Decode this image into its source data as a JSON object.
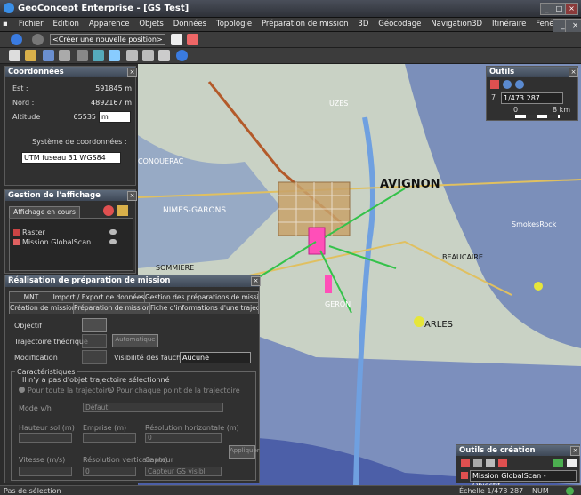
{
  "window": {
    "title": "GeoConcept Enterprise - [GS Test]"
  },
  "menu": [
    "Fichier",
    "Edition",
    "Apparence",
    "Objets",
    "Données",
    "Topologie",
    "Préparation de mission",
    "3D",
    "Géocodage",
    "Navigation3D",
    "Itinéraire",
    "Fenêtres",
    "?"
  ],
  "toolbar": {
    "position_combo": "<Créer une nouvelle position>"
  },
  "coords": {
    "title": "Coordonnées",
    "est_label": "Est :",
    "est_value": "591845 m",
    "nord_label": "Nord :",
    "nord_value": "4892167 m",
    "alt_label": "Altitude",
    "alt_value": "65535",
    "alt_unit": "m",
    "system_label": "Système de coordonnées :",
    "system_value": "UTM fuseau 31 WGS84"
  },
  "display": {
    "title": "Gestion de l'affichage",
    "tab": "Affichage en cours",
    "layers": [
      "Raster",
      "Mission GlobalScan"
    ]
  },
  "mission": {
    "title": "Réalisation de préparation de mission",
    "tabs_row1": [
      "MNT",
      "Import / Export de données",
      "Gestion des préparations de mission"
    ],
    "tabs_row2": [
      "Création de mission",
      "Préparation de mission",
      "Fiche d'informations d'une trajectoire"
    ],
    "objectif": "Objectif",
    "trajectoire": "Trajectoire théorique",
    "modification": "Modification",
    "automatique": "Automatique",
    "visibilite": "Visibilité des fauchées",
    "visibilite_value": "Aucune",
    "caracteristiques": "Caractéristiques",
    "no_object": "Il n'y a pas d'objet trajectoire sélectionné",
    "radio1": "Pour toute la trajectoire",
    "radio2": "Pour chaque point de la trajectoire",
    "mode_label": "Mode v/h",
    "mode_value": "Défaut",
    "hauteur": "Hauteur sol (m)",
    "emprise": "Emprise (m)",
    "res_h": "Résolution horizontale (m)",
    "res_h_value": "0",
    "appliquer": "Appliquer",
    "vitesse": "Vitesse (m/s)",
    "res_v": "Résolution verticale (m)",
    "res_v_value": "0",
    "capteur": "Capteur",
    "capteur_value": "Capteur GS visibl"
  },
  "outils": {
    "title": "Outils",
    "scale_combo": "1/473 287",
    "side_num": "7",
    "scale_0": "0",
    "scale_8": "8 km"
  },
  "creation": {
    "title": "Outils de création",
    "combo": "Mission GlobalScan - Objectif"
  },
  "status": {
    "left": "Pas de sélection",
    "scale": "Échelle 1/473 287",
    "num": "NUM"
  },
  "map_labels": [
    "AVIGNON",
    "NIMES-GARONS",
    "ARLES",
    "BEAUCAIRE",
    "SmokesRock",
    "CONQUERAC",
    "GERON",
    "SOMMIERE",
    "UZES"
  ],
  "colors": {
    "accent": "#3a6fd8",
    "map_bg": "#c6d0c2",
    "flight_area": "#c8a26a",
    "pink": "#ff4fb8",
    "green_track": "#34c24a"
  }
}
